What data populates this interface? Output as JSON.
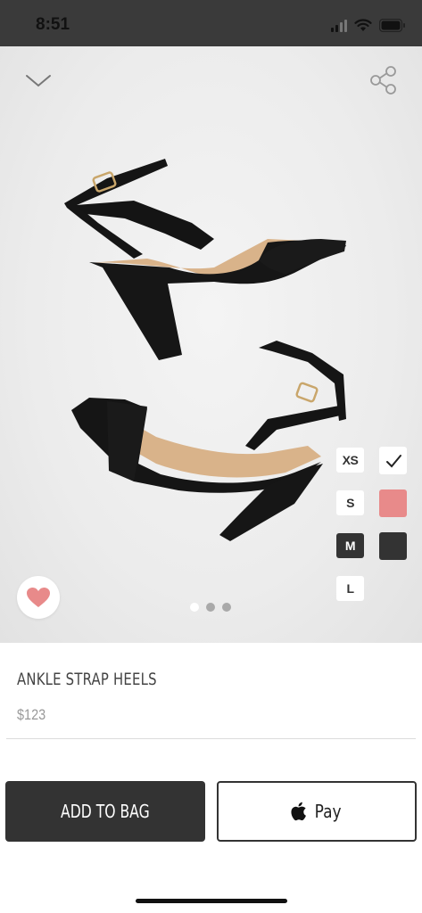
{
  "status_bar": {
    "time": "8:51"
  },
  "product": {
    "title": "ANKLE STRAP HEELS",
    "price": "$123"
  },
  "gallery": {
    "image_count": 3,
    "active_index": 0
  },
  "sizes": [
    {
      "label": "XS",
      "selected": false
    },
    {
      "label": "S",
      "selected": false
    },
    {
      "label": "M",
      "selected": true
    },
    {
      "label": "L",
      "selected": false
    }
  ],
  "colors": [
    {
      "name": "check-icon",
      "hex": "#ffffff"
    },
    {
      "name": "pink",
      "hex": "#e88a8a"
    },
    {
      "name": "black",
      "hex": "#333333"
    }
  ],
  "actions": {
    "add_to_bag": "ADD TO BAG",
    "apple_pay": "Pay"
  },
  "icons": {
    "back": "chevron-down-icon",
    "share": "share-icon",
    "favorite": "heart-icon",
    "apple": "apple-logo-icon"
  },
  "theme": {
    "dark": "#333333",
    "accent_pink": "#e88a8a",
    "price_gray": "#999999"
  }
}
